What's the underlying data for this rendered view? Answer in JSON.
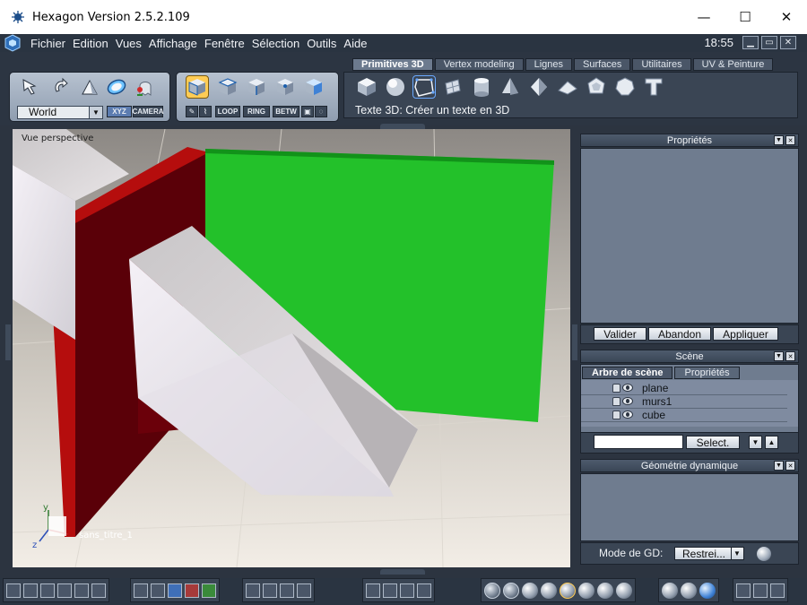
{
  "window": {
    "title": "Hexagon Version 2.5.2.109",
    "minimize": "—",
    "maximize": "☐",
    "close": "✕"
  },
  "menu": {
    "items": [
      "Fichier",
      "Edition",
      "Vues",
      "Affichage",
      "Fenêtre",
      "Sélection",
      "Outils",
      "Aide"
    ],
    "clock": "18:55"
  },
  "toolbar": {
    "coord_select": "World",
    "xyz_label": "XYZ",
    "camera_label": "CAMERA",
    "loop_label": "LOOP",
    "ring_label": "RING",
    "betw_label": "BETW",
    "tabs": [
      "Primitives 3D",
      "Vertex modeling",
      "Lignes",
      "Surfaces",
      "Utilitaires",
      "UV & Peinture"
    ],
    "active_tab": "Primitives 3D",
    "status": "Texte 3D: Créer un texte en 3D"
  },
  "viewport": {
    "label": "Vue perspective",
    "object_label": "sans_titre_1",
    "axis_y": "y",
    "axis_z": "z"
  },
  "properties_panel": {
    "title": "Propriétés",
    "validate": "Valider",
    "abandon": "Abandon",
    "apply": "Appliquer"
  },
  "scene_panel": {
    "title": "Scène",
    "tab_tree": "Arbre de scène",
    "tab_props": "Propriétés",
    "items": [
      "plane",
      "murs1",
      "cube"
    ],
    "select_button": "Select."
  },
  "dyn_geometry_panel": {
    "title": "Géométrie dynamique",
    "mode_label": "Mode de GD:",
    "mode_value": "Restrei..."
  },
  "colors": {
    "green_plane": "#23c12a",
    "wall_red": "#b50d0d",
    "wall_dark": "#5a0008",
    "ui_dark": "#2c3542",
    "panel_blue": "#6f7c8f"
  }
}
